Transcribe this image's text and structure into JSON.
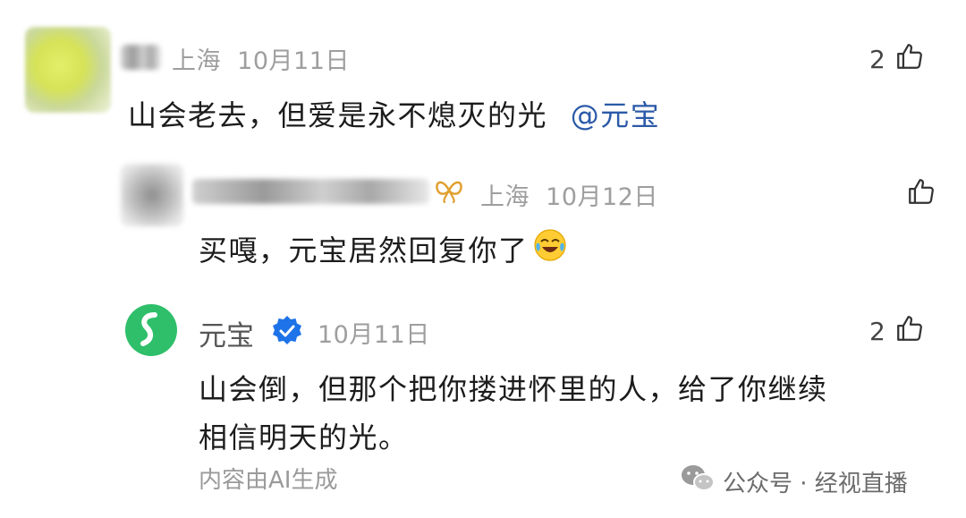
{
  "comments": [
    {
      "location": "上海",
      "date": "10月11日",
      "like_count": "2",
      "text": "山会老去，但爱是永不熄灭的光",
      "mention": "@元宝"
    },
    {
      "location": "上海",
      "date": "10月12日",
      "like_count": "",
      "text": "买嘎，元宝居然回复你了"
    },
    {
      "name": "元宝",
      "date": "10月11日",
      "like_count": "2",
      "text_line1": "山会倒，但那个把你搂进怀里的人，给了你继续",
      "text_line2": "相信明天的光。",
      "ai_note": "内容由AI生成"
    }
  ],
  "watermark": {
    "label": "公众号 · 经视直播"
  },
  "icons": {
    "like": "thumbs-up-icon",
    "verified": "verified-badge-icon",
    "emoji": "laughing-crying-emoji-icon",
    "wechat": "wechat-icon",
    "level": "butterfly-badge-icon"
  },
  "colors": {
    "mention": "#2b5aa8",
    "meta": "#9e9e9e",
    "verified_blue": "#1e73e8",
    "logo_green": "#2fbf6a"
  }
}
